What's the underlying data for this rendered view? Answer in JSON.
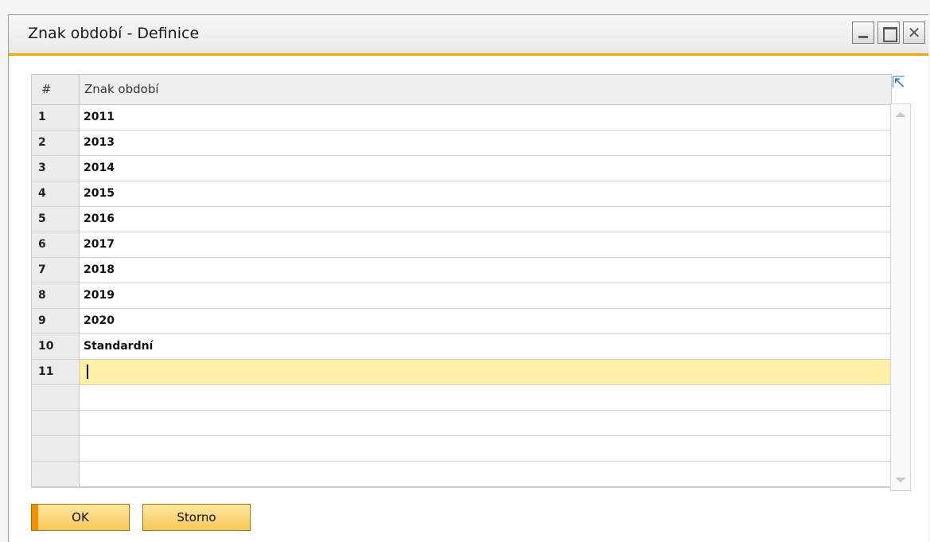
{
  "window": {
    "title": "Znak období - Definice",
    "controls": {
      "minimize": "minimize-icon",
      "maximize": "maximize-icon",
      "close": "close-icon"
    }
  },
  "grid": {
    "columns": [
      "#",
      "Znak období"
    ],
    "rows": [
      {
        "num": "1",
        "value": "2011"
      },
      {
        "num": "2",
        "value": "2013"
      },
      {
        "num": "3",
        "value": "2014"
      },
      {
        "num": "4",
        "value": "2015"
      },
      {
        "num": "5",
        "value": "2016"
      },
      {
        "num": "6",
        "value": "2017"
      },
      {
        "num": "7",
        "value": "2018"
      },
      {
        "num": "8",
        "value": "2019"
      },
      {
        "num": "9",
        "value": "2020"
      },
      {
        "num": "10",
        "value": "Standardní"
      },
      {
        "num": "11",
        "value": ""
      },
      {
        "num": "",
        "value": ""
      },
      {
        "num": "",
        "value": ""
      },
      {
        "num": "",
        "value": ""
      },
      {
        "num": "",
        "value": ""
      }
    ],
    "active_row": 10
  },
  "buttons": {
    "ok": "OK",
    "cancel": "Storno"
  },
  "colors": {
    "accent": "#f0a800",
    "active_row": "#fff0a8",
    "button": "#f6c85a"
  }
}
